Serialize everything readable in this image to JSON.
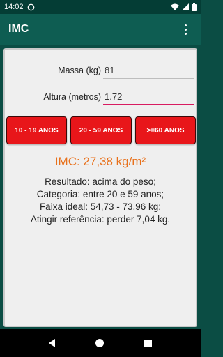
{
  "status_bar": {
    "time": "14:02"
  },
  "app_bar": {
    "title": "IMC"
  },
  "form": {
    "mass_label": "Massa (kg)",
    "mass_value": "81",
    "height_label": "Altura (metros)",
    "height_value": "1.72"
  },
  "buttons": {
    "age1": "10 - 19 ANOS",
    "age2": "20 - 59 ANOS",
    "age3": ">=60 ANOS"
  },
  "result": {
    "imc": "IMC: 27,38 kg/m²",
    "line1": "Resultado: acima do peso;",
    "line2": "Categoria: entre 20 e 59 anos;",
    "line3": "Faixa ideal: 54,73 - 73,96 kg;",
    "line4": "Atingir referência: perder 7,04 kg."
  },
  "colors": {
    "accent": "#e8161a",
    "result_text": "#e8711c",
    "app_bar": "#0e5d52",
    "focus_underline": "#d81b60"
  }
}
